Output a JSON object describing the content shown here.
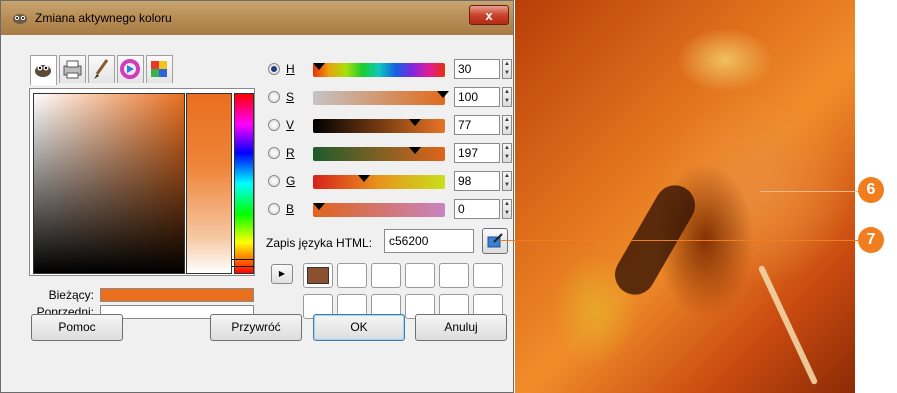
{
  "window": {
    "title": "Zmiana aktywnego koloru",
    "close_label": "x"
  },
  "tabs": [
    {
      "icon": "gimp-icon"
    },
    {
      "icon": "printer-icon"
    },
    {
      "icon": "brush-icon"
    },
    {
      "icon": "color-wheel-icon"
    },
    {
      "icon": "palette-icon"
    }
  ],
  "compare": {
    "current_label": "Bieżący:",
    "previous_label": "Poprzedni:",
    "current_color": "#e96f1f",
    "previous_color": "#ffffff"
  },
  "channels": [
    {
      "key": "H",
      "value": "30",
      "selected": true
    },
    {
      "key": "S",
      "value": "100",
      "selected": false
    },
    {
      "key": "V",
      "value": "77",
      "selected": false
    },
    {
      "key": "R",
      "value": "197",
      "selected": false
    },
    {
      "key": "G",
      "value": "98",
      "selected": false
    },
    {
      "key": "B",
      "value": "0",
      "selected": false
    }
  ],
  "html_notation": {
    "label": "Zapis języka HTML:",
    "value": "c56200"
  },
  "history": {
    "first_color": "#8a5030"
  },
  "buttons": {
    "help": "Pomoc",
    "reset": "Przywróć",
    "ok": "OK",
    "cancel": "Anuluj"
  },
  "callouts": {
    "six": "6",
    "seven": "7"
  },
  "colors": {
    "accent": "#f07e1e"
  }
}
